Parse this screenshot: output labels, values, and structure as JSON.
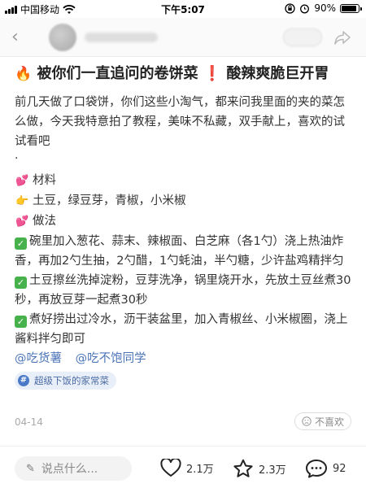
{
  "status_bar": {
    "carrier": "中国移动",
    "time": "下午5:07",
    "battery": "90%",
    "battery_level": 0.9
  },
  "post": {
    "title": "被你们一直追问的卷饼菜",
    "title_tail": "酸辣爽脆巨开胃",
    "intro": "前几天做了口袋饼，你们这些小淘气，都来问我里面的夹的菜怎么做，今天我特意拍了教程，美味不私藏，双手献上，喜欢的试试看吧",
    "dot": "·",
    "materials_heading": "材料",
    "materials": "土豆，绿豆芽，青椒，小米椒",
    "method_heading": "做法",
    "steps": [
      "碗里加入葱花、蒜末、辣椒面、白芝麻（各1勺）浇上热油炸香，再加2勺生抽，2勺醋，1勺蚝油，半勺糖，少许盐鸡精拌匀",
      "土豆擦丝洗掉淀粉，豆芽洗净，锅里烧开水，先放土豆丝煮30秒，再放豆芽一起煮30秒",
      "煮好捞出过冷水，沥干装盆里，加入青椒丝、小米椒圈，浇上酱料拌匀即可"
    ],
    "mentions": [
      "@吃货薯",
      "@吃不饱同学"
    ],
    "topic": "超级下饭的家常菜",
    "date": "04-14",
    "dislike": "不喜欢"
  },
  "bottom_bar": {
    "comment_placeholder": "说点什么...",
    "likes": "2.1万",
    "collects": "2.3万",
    "comments": "92"
  },
  "icons": {
    "back": "chevron-left-icon",
    "share": "share-icon",
    "fire": "fire-icon",
    "exclaim": "exclamation-icon",
    "heart_emoji": "two-hearts-icon",
    "point": "pointing-hand-icon",
    "check": "check-mark-icon",
    "topic": "hashtag-icon",
    "dislike": "sad-face-icon",
    "pen": "pen-icon",
    "like": "heart-icon",
    "collect": "star-icon",
    "comment": "comment-icon"
  },
  "colors": {
    "mention": "#4b74b8",
    "check": "#47b14b",
    "topic_bg": "#e9eff8"
  }
}
